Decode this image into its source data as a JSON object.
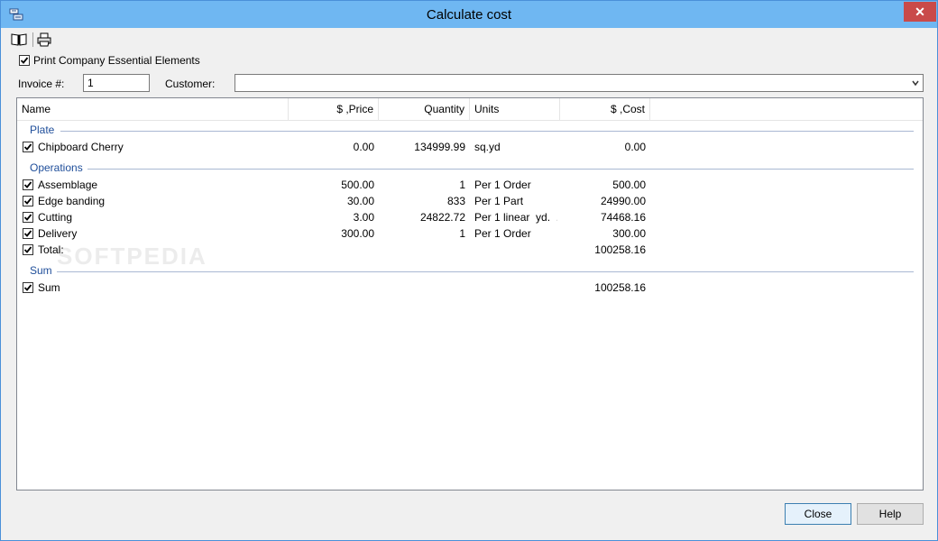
{
  "window": {
    "title": "Calculate cost",
    "close_glyph": "✕"
  },
  "toolbar": {
    "book_icon": "book-icon",
    "print_icon": "printer-icon"
  },
  "options": {
    "print_company_label": "Print Company Essential Elements",
    "print_company_checked": true
  },
  "invoice": {
    "label": "Invoice #:",
    "value": "1"
  },
  "customer": {
    "label": "Customer:",
    "value": ""
  },
  "columns": [
    "Name",
    "$ ,Price",
    "Quantity",
    "Units",
    "$ ,Cost"
  ],
  "groups": {
    "plate": {
      "label": "Plate",
      "rows": [
        {
          "name": "Chipboard Cherry",
          "price": "0.00",
          "quantity": "134999.99",
          "units": "sq.yd",
          "cost": "0.00"
        }
      ]
    },
    "operations": {
      "label": "Operations",
      "rows": [
        {
          "name": "Assemblage",
          "price": "500.00",
          "quantity": "1",
          "units": "Per 1 Order",
          "cost": "500.00"
        },
        {
          "name": "Edge banding",
          "price": "30.00",
          "quantity": "833",
          "units": "Per 1 Part",
          "cost": "24990.00"
        },
        {
          "name": "Cutting",
          "price": "3.00",
          "quantity": "24822.72",
          "units": "Per 1 linear  yd.  ...",
          "cost": "74468.16"
        },
        {
          "name": "Delivery",
          "price": "300.00",
          "quantity": "1",
          "units": "Per 1 Order",
          "cost": "300.00"
        },
        {
          "name": "Total:",
          "price": "",
          "quantity": "",
          "units": "",
          "cost": "100258.16"
        }
      ]
    },
    "sum": {
      "label": "Sum",
      "rows": [
        {
          "name": "Sum",
          "price": "",
          "quantity": "",
          "units": "",
          "cost": "100258.16"
        }
      ]
    }
  },
  "watermark": "SOFTPEDIA",
  "buttons": {
    "close": "Close",
    "help": "Help"
  }
}
